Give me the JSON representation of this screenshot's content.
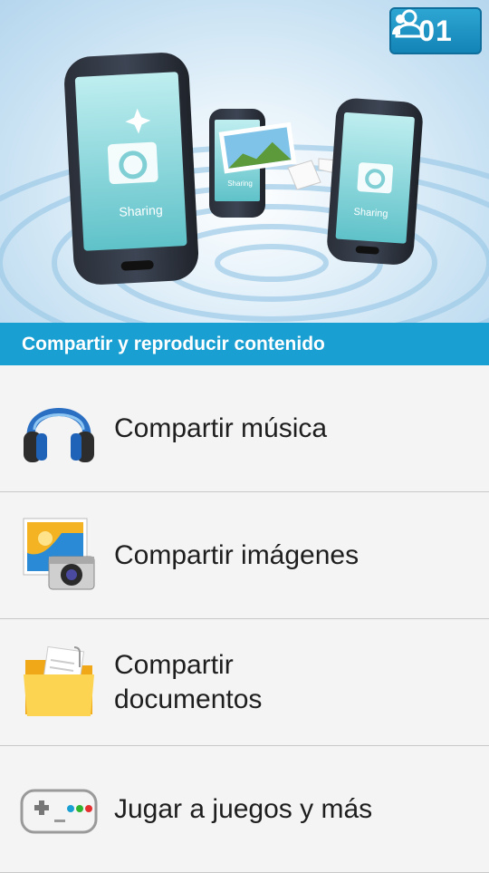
{
  "hero": {
    "phone_label": "Sharing",
    "counter_value": "01",
    "counter_icon": "people-icon"
  },
  "section": {
    "title": "Compartir y reproducir contenido"
  },
  "items": [
    {
      "label": "Compartir música",
      "icon": "headphones-icon"
    },
    {
      "label": "Compartir imágenes",
      "icon": "picture-camera-icon"
    },
    {
      "label": "Compartir documentos",
      "icon": "folder-icon"
    },
    {
      "label": "Jugar a juegos y más",
      "icon": "gamepad-icon"
    }
  ],
  "colors": {
    "accent": "#1a9fd2",
    "counter_bg": "#1c8ec2"
  }
}
